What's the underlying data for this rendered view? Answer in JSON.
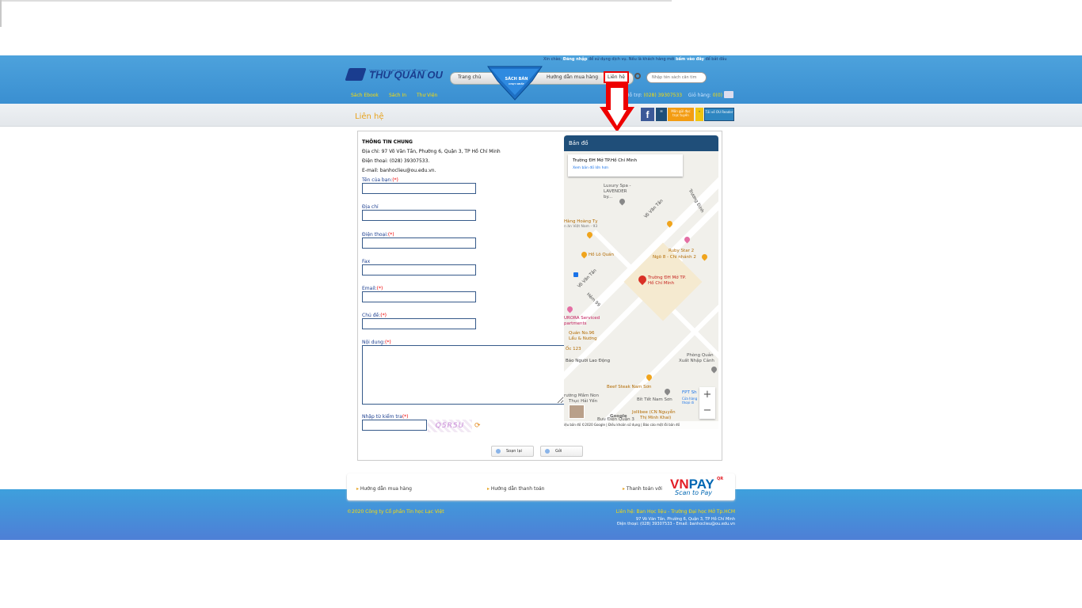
{
  "header": {
    "logo_text": "THƯ QUÁN OU",
    "logo_small": "TRƯỜNG ĐẠI HỌC MỞ THÀNH PHỐ HỒ CHÍ MINH",
    "greeting_prefix": "Xin chào,",
    "login_label": "Đăng nhập",
    "greeting_mid": "để sử dụng dịch vụ. Nếu là khách hàng mới",
    "register_label": "bấm vào đây",
    "greeting_suffix": "để bắt đầu",
    "nav_home": "Trang chủ",
    "badge_line1": "SÁCH BÁN",
    "badge_line2": "CHẠY NHẤT",
    "nav_guide": "Hướng dẫn mua hàng",
    "nav_contact": "Liên hệ",
    "search_placeholder": "Nhập tên sách cần tìm",
    "subnav": [
      "Sách Ebook",
      "Sách In",
      "Thư Viện"
    ],
    "support_label": "Hỗ trợ:",
    "support_phone": "(028) 39307533",
    "cart_label": "Giỏ hàng:",
    "cart_count": "0(0)"
  },
  "subbar": {
    "page_title": "Liên hệ",
    "fb_label": "f",
    "banner1": "Môn gửi đọc trực tuyến",
    "banner2": "Tải về OU Reader"
  },
  "contact_info": {
    "title": "THÔNG TIN CHUNG",
    "address": "Địa chỉ: 97 Võ Văn Tần, Phường 6, Quận 3, TP Hồ Chí Minh",
    "phone": "Điện thoại: (028) 39307533.",
    "email": "E-mail: banhoclieu@ou.edu.vn."
  },
  "form": {
    "name_label": "Tên của bạn:",
    "address_label": "Địa chỉ",
    "phone_label": "Điện thoại:",
    "fax_label": "Fax",
    "email_label": "Email:",
    "subject_label": "Chủ đề:",
    "content_label": "Nội dung:",
    "captcha_label": "Nhập từ kiểm tra",
    "required_mark": "(*)",
    "captcha_text": "Q5R5U",
    "reset_label": "Soạn lại",
    "send_label": "Gởi"
  },
  "map": {
    "title": "Bản đồ",
    "card_title": "Trường ĐH Mở TP.Hồ Chí Minh",
    "card_link": "Xem bản đồ lớn hơn",
    "labels": {
      "luxury_spa": "Luxury Spa - LAVENDER by...",
      "vo_van_tan_1": "Võ Văn Tần",
      "truong_dinh": "Trương Định",
      "hoang_ty": "Hàng Hoàng Tỵ",
      "hoang_ty_sub": "n ăn Việt Nam - 93",
      "ruby_star": "Ruby Star 2",
      "ngo_8": "Ngõ 8 - Chi nhánh 2",
      "ho_lo_quan": "Hồ Lô Quán",
      "vo_van_tan_2": "Võ Văn Tần",
      "school": "Trường ĐH Mở TP. Hồ Chí Minh",
      "hem_99": "Hẻm 99",
      "aurora": "URORA Serviced",
      "aurora2": "partments",
      "quan_no_96": "Quán No.96",
      "lau_nuong": "Lẩu & Nướng",
      "oc_123": "Ốc 123",
      "bao_nld": "Báo Người Lao Động",
      "phong_quan": "Phòng Quản",
      "xuat_nhap": "Xuất Nhập Cảnh",
      "beef": "Beef Steak Nam Sơn",
      "fpt": "FPT Sh",
      "fpt2": "Cửa hàng",
      "fpt3": "thoại di",
      "mam_non": "rường Mầm Non",
      "thuc_hai_yen": "Thục Hải Yến",
      "bit_tet": "Bít Tết Nam Sơn",
      "jollibee": "Jollibee (CN Nguyễn",
      "jollibee2": "Thị Minh Khai)",
      "buu_dien": "Bưu Điện Quận 3",
      "google": "Google",
      "zoom_in": "+",
      "zoom_out": "−"
    },
    "footer": "iệu bản đồ ©2020 Google | Điều khoản sử dụng | Báo cáo một lỗi bản đồ"
  },
  "footer": {
    "link1": "Hướng dẫn mua hàng",
    "link2": "Hướng dẫn thanh toán",
    "link3": "Thanh toán với",
    "vnpay_vn": "VN",
    "vnpay_pay": "PAY",
    "vnpay_qr": "QR",
    "vnpay_sub": "Scan to Pay",
    "copyright": "©2020 Công ty Cổ phần Tin học Lạc Việt",
    "contact": "Liên hệ: Ban Học liệu - Trường Đại học Mở Tp.HCM",
    "address": "97 Võ Văn Tần, Phường 6, Quận 3, TP Hồ Chí Minh",
    "phone_email": "Điện thoại: (028) 39307533 - Email: banhoclieu@ou.edu.vn"
  },
  "colors": {
    "header_blue": "#3a8fd1",
    "accent_yellow": "#ffde00",
    "title_orange": "#e7a31e",
    "highlight_red": "#e00000",
    "map_header": "#1f4e79"
  }
}
